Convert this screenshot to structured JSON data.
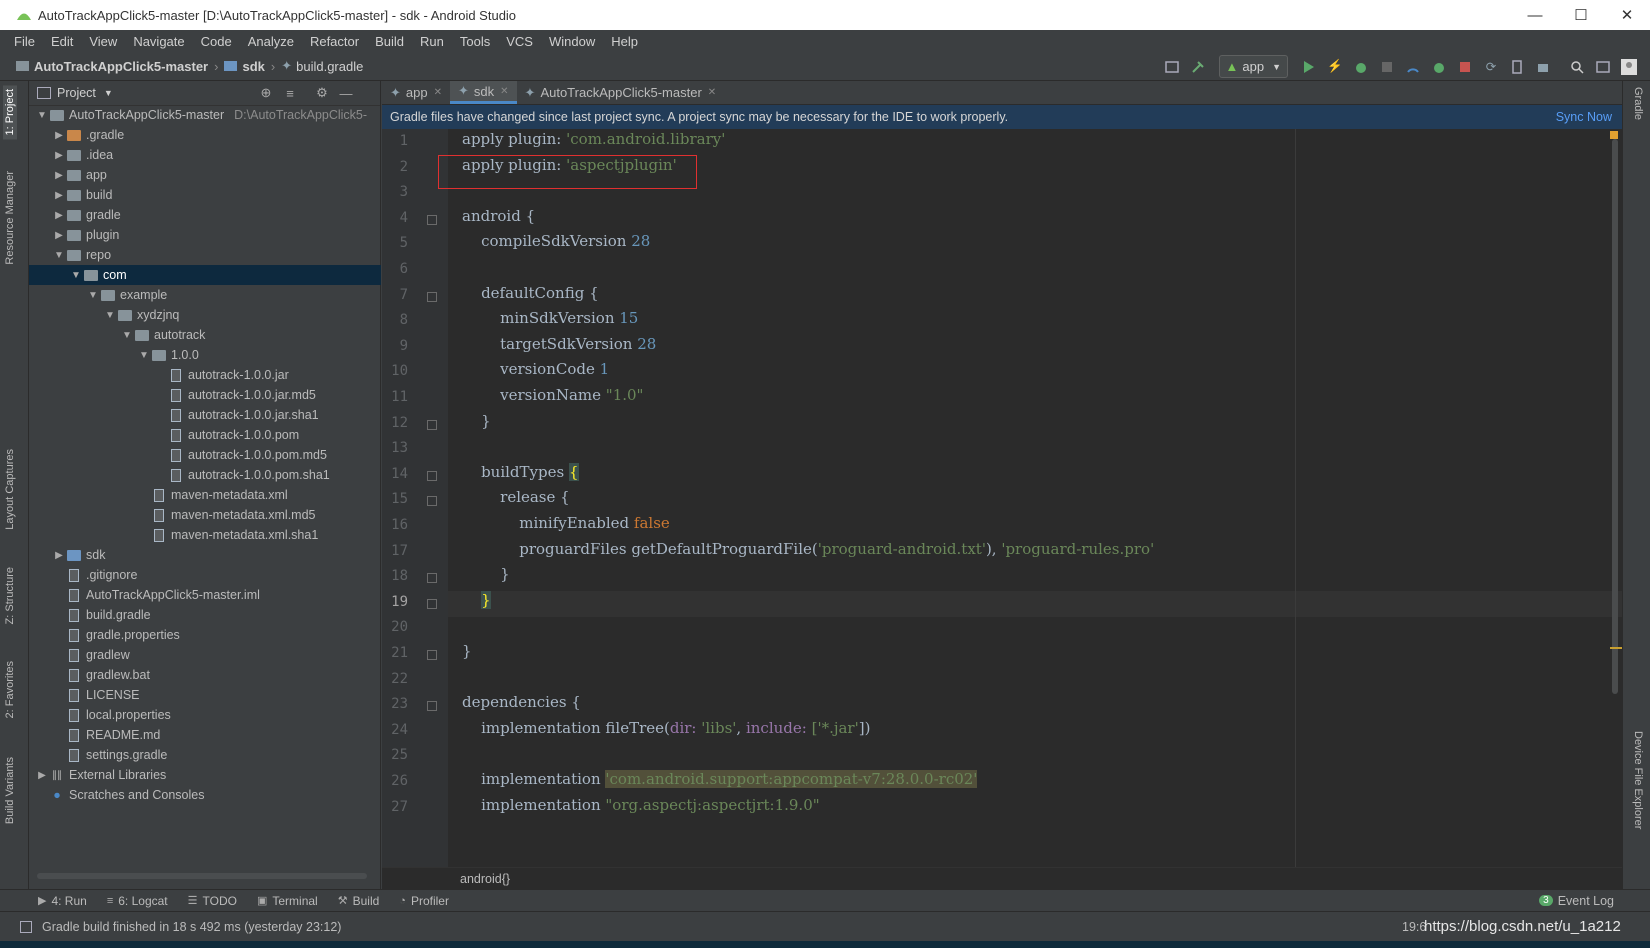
{
  "window": {
    "title": "AutoTrackAppClick5-master [D:\\AutoTrackAppClick5-master] - sdk - Android Studio"
  },
  "menu": [
    "File",
    "Edit",
    "View",
    "Navigate",
    "Code",
    "Analyze",
    "Refactor",
    "Build",
    "Run",
    "Tools",
    "VCS",
    "Window",
    "Help"
  ],
  "nav": {
    "project": "AutoTrackAppClick5-master",
    "module": "sdk",
    "file": "build.gradle",
    "run_config": "app"
  },
  "left_tabs": [
    "1: Project",
    "Resource Manager",
    "Layout Captures",
    "Z: Structure",
    "2: Favorites",
    "Build Variants"
  ],
  "right_tabs": [
    "Gradle",
    "Device File Explorer"
  ],
  "project_panel": {
    "title": "Project",
    "tree": [
      {
        "label": "AutoTrackAppClick5-master",
        "suffix": "D:\\AutoTrackAppClick5-",
        "depth": 0,
        "arrow": "open",
        "icon": "folder"
      },
      {
        "label": ".gradle",
        "depth": 1,
        "arrow": "closed",
        "icon": "folder-orange"
      },
      {
        "label": ".idea",
        "depth": 1,
        "arrow": "closed",
        "icon": "folder"
      },
      {
        "label": "app",
        "depth": 1,
        "arrow": "closed",
        "icon": "folder"
      },
      {
        "label": "build",
        "depth": 1,
        "arrow": "closed",
        "icon": "folder"
      },
      {
        "label": "gradle",
        "depth": 1,
        "arrow": "closed",
        "icon": "folder"
      },
      {
        "label": "plugin",
        "depth": 1,
        "arrow": "closed",
        "icon": "folder"
      },
      {
        "label": "repo",
        "depth": 1,
        "arrow": "open",
        "icon": "folder"
      },
      {
        "label": "com",
        "depth": 2,
        "arrow": "open",
        "icon": "folder",
        "selected": true
      },
      {
        "label": "example",
        "depth": 3,
        "arrow": "open",
        "icon": "folder"
      },
      {
        "label": "xydzjnq",
        "depth": 4,
        "arrow": "open",
        "icon": "folder"
      },
      {
        "label": "autotrack",
        "depth": 5,
        "arrow": "open",
        "icon": "folder"
      },
      {
        "label": "1.0.0",
        "depth": 6,
        "arrow": "open",
        "icon": "folder"
      },
      {
        "label": "autotrack-1.0.0.jar",
        "depth": 7,
        "arrow": "none",
        "icon": "file"
      },
      {
        "label": "autotrack-1.0.0.jar.md5",
        "depth": 7,
        "arrow": "none",
        "icon": "file"
      },
      {
        "label": "autotrack-1.0.0.jar.sha1",
        "depth": 7,
        "arrow": "none",
        "icon": "file"
      },
      {
        "label": "autotrack-1.0.0.pom",
        "depth": 7,
        "arrow": "none",
        "icon": "file"
      },
      {
        "label": "autotrack-1.0.0.pom.md5",
        "depth": 7,
        "arrow": "none",
        "icon": "file"
      },
      {
        "label": "autotrack-1.0.0.pom.sha1",
        "depth": 7,
        "arrow": "none",
        "icon": "file"
      },
      {
        "label": "maven-metadata.xml",
        "depth": 6,
        "arrow": "none",
        "icon": "file"
      },
      {
        "label": "maven-metadata.xml.md5",
        "depth": 6,
        "arrow": "none",
        "icon": "file"
      },
      {
        "label": "maven-metadata.xml.sha1",
        "depth": 6,
        "arrow": "none",
        "icon": "file"
      },
      {
        "label": "sdk",
        "depth": 1,
        "arrow": "closed",
        "icon": "folder-blue"
      },
      {
        "label": ".gitignore",
        "depth": 1,
        "arrow": "none",
        "icon": "file"
      },
      {
        "label": "AutoTrackAppClick5-master.iml",
        "depth": 1,
        "arrow": "none",
        "icon": "file"
      },
      {
        "label": "build.gradle",
        "depth": 1,
        "arrow": "none",
        "icon": "file"
      },
      {
        "label": "gradle.properties",
        "depth": 1,
        "arrow": "none",
        "icon": "file"
      },
      {
        "label": "gradlew",
        "depth": 1,
        "arrow": "none",
        "icon": "file"
      },
      {
        "label": "gradlew.bat",
        "depth": 1,
        "arrow": "none",
        "icon": "file"
      },
      {
        "label": "LICENSE",
        "depth": 1,
        "arrow": "none",
        "icon": "file"
      },
      {
        "label": "local.properties",
        "depth": 1,
        "arrow": "none",
        "icon": "file"
      },
      {
        "label": "README.md",
        "depth": 1,
        "arrow": "none",
        "icon": "file"
      },
      {
        "label": "settings.gradle",
        "depth": 1,
        "arrow": "none",
        "icon": "file"
      },
      {
        "label": "External Libraries",
        "depth": 0,
        "arrow": "closed",
        "icon": "lib"
      },
      {
        "label": "Scratches and Consoles",
        "depth": 0,
        "arrow": "none",
        "icon": "scratch"
      }
    ]
  },
  "editor_tabs": [
    {
      "label": "app",
      "active": false
    },
    {
      "label": "sdk",
      "active": true
    },
    {
      "label": "AutoTrackAppClick5-master",
      "active": false
    }
  ],
  "banner": {
    "message": "Gradle files have changed since last project sync. A project sync may be necessary for the IDE to work properly.",
    "action": "Sync Now"
  },
  "code_lines": [
    "1",
    "2",
    "3",
    "4",
    "5",
    "6",
    "7",
    "8",
    "9",
    "10",
    "11",
    "12",
    "13",
    "14",
    "15",
    "16",
    "17",
    "18",
    "19",
    "20",
    "21",
    "22",
    "23",
    "24",
    "25",
    "26",
    "27"
  ],
  "code": {
    "l1": [
      "apply plugin: ",
      "'com.android.library'"
    ],
    "l2": [
      "apply plugin: ",
      "'aspectjplugin'"
    ],
    "l4": "android {",
    "l5": [
      "    compileSdkVersion ",
      "28"
    ],
    "l7": "    defaultConfig {",
    "l8": [
      "        minSdkVersion ",
      "15"
    ],
    "l9": [
      "        targetSdkVersion ",
      "28"
    ],
    "l10": [
      "        versionCode ",
      "1"
    ],
    "l11": [
      "        versionName ",
      "\"1.0\""
    ],
    "l12": "    }",
    "l14": [
      "    buildTypes ",
      "{"
    ],
    "l15": "        release {",
    "l16": [
      "            minifyEnabled ",
      "false"
    ],
    "l17": [
      "            proguardFiles getDefaultProguardFile(",
      "'proguard-android.txt'",
      "), ",
      "'proguard-rules.pro'"
    ],
    "l18": "        }",
    "l19": [
      "    ",
      "}"
    ],
    "l21": "}",
    "l23": "dependencies {",
    "l24": [
      "    implementation fileTree(",
      "dir: ",
      "'libs'",
      ", ",
      "include: ",
      "['*.jar'",
      "])"
    ],
    "l26": [
      "    implementation ",
      "'com.android.support:appcompat-v7:28.0.0-rc02'"
    ],
    "l27": [
      "    implementation ",
      "\"org.aspectj:aspectjrt:1.9.0\""
    ]
  },
  "editor_breadcrumb": "android{}",
  "bottom_tools": [
    {
      "icon": "run-icon",
      "label": "4: Run"
    },
    {
      "icon": "logcat-icon",
      "label": "6: Logcat"
    },
    {
      "icon": "todo-icon",
      "label": "TODO"
    },
    {
      "icon": "terminal-icon",
      "label": "Terminal"
    },
    {
      "icon": "build-icon",
      "label": "Build"
    },
    {
      "icon": "profiler-icon",
      "label": "Profiler"
    }
  ],
  "event_log": {
    "count": "3",
    "label": "Event Log"
  },
  "status": {
    "message": "Gradle build finished in 18 s 492 ms (yesterday 23:12)",
    "position": "19:6",
    "watermark": "https://blog.csdn.net/u_1a212"
  }
}
